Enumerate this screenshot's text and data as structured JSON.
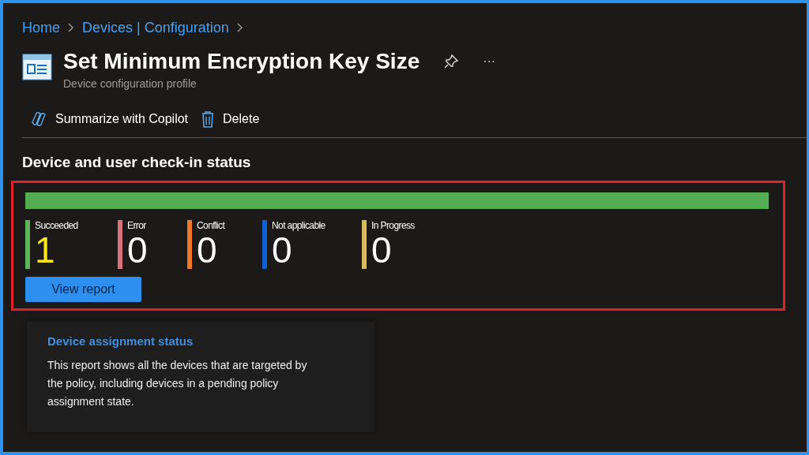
{
  "breadcrumb": [
    {
      "label": "Home"
    },
    {
      "label": "Devices | Configuration"
    }
  ],
  "header": {
    "title": "Set Minimum Encryption Key Size",
    "subtitle": "Device configuration profile",
    "more": "···"
  },
  "toolbar": [
    {
      "kind": "copilot",
      "label": "Summarize with Copilot"
    },
    {
      "kind": "delete",
      "label": "Delete"
    }
  ],
  "checkin": {
    "heading": "Device and user check-in status",
    "level": 1,
    "stats": [
      {
        "label": "Succeeded",
        "value": "1",
        "color": "#5db55a",
        "highlighted": true
      },
      {
        "label": "Error",
        "value": "0",
        "color": "#d9737a",
        "highlighted": false
      },
      {
        "label": "Conflict",
        "value": "0",
        "color": "#f0782a",
        "highlighted": false
      },
      {
        "label": "Not applicable",
        "value": "0",
        "color": "#0f5fd6",
        "highlighted": false
      },
      {
        "label": "In Progress",
        "value": "0",
        "color": "#d9b95c",
        "highlighted": false
      }
    ],
    "button": "View report"
  },
  "card": {
    "title": "Device assignment status",
    "text": "This report shows all the devices that are targeted by the policy, including devices in a pending policy assignment state."
  }
}
